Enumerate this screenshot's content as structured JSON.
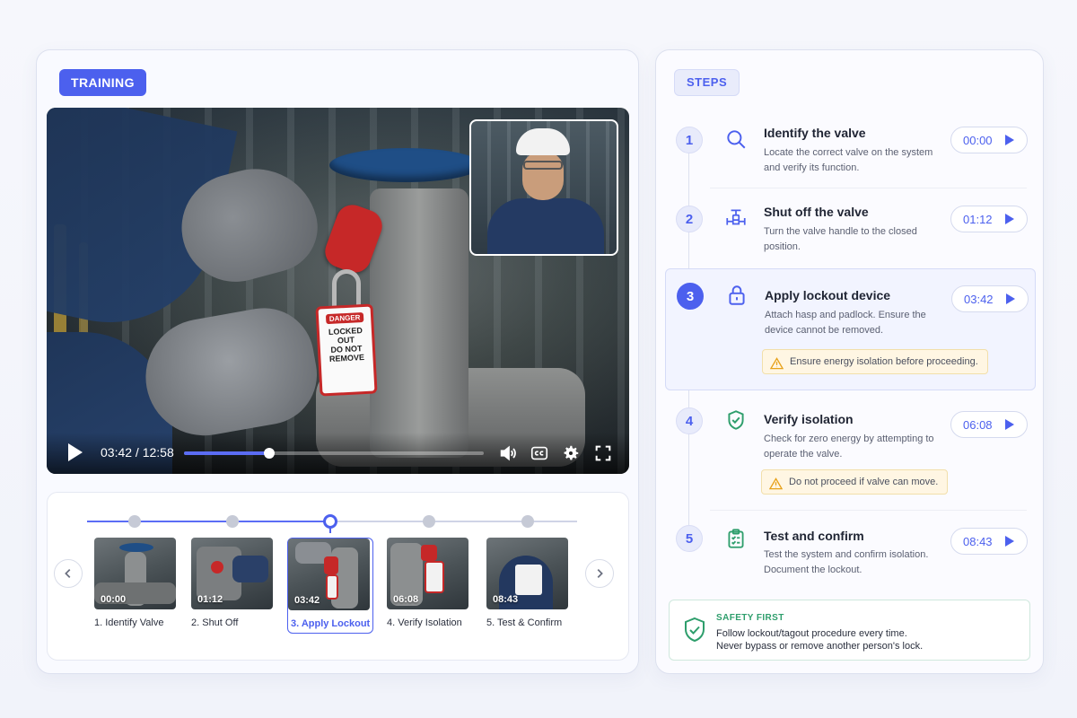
{
  "training_badge": "TRAINING",
  "steps_badge": "STEPS",
  "video": {
    "time_display": "03:42 / 12:58",
    "progress_fraction": 0.2856,
    "tag_danger": "DANGER",
    "tag_line1": "LOCKED",
    "tag_line2": "OUT",
    "tag_line3": "DO NOT",
    "tag_line4": "REMOVE"
  },
  "thumbnails": [
    {
      "time": "00:00",
      "label": "1. Identify Valve",
      "active": false
    },
    {
      "time": "01:12",
      "label": "2. Shut Off",
      "active": false
    },
    {
      "time": "03:42",
      "label": "3. Apply Lockout",
      "active": true
    },
    {
      "time": "06:08",
      "label": "4. Verify Isolation",
      "active": false
    },
    {
      "time": "08:43",
      "label": "5. Test & Confirm",
      "active": false
    }
  ],
  "steps": [
    {
      "num": "1",
      "title": "Identify the valve",
      "desc": "Locate the correct valve on the system and verify its function.",
      "time": "00:00",
      "icon": "search-icon"
    },
    {
      "num": "2",
      "title": "Shut off the valve",
      "desc": "Turn the valve handle to the closed position.",
      "time": "01:12",
      "icon": "valve-icon"
    },
    {
      "num": "3",
      "title": "Apply lockout device",
      "desc": "Attach hasp and padlock. Ensure the device cannot be removed.",
      "time": "03:42",
      "icon": "lock-icon",
      "warning": "Ensure energy isolation before proceeding."
    },
    {
      "num": "4",
      "title": "Verify isolation",
      "desc": "Check for zero energy by attempting to operate the valve.",
      "time": "06:08",
      "icon": "shield-check-icon",
      "warning": "Do not proceed if valve can move."
    },
    {
      "num": "5",
      "title": "Test and confirm",
      "desc": "Test the system and confirm isolation. Document the lockout.",
      "time": "08:43",
      "icon": "clipboard-check-icon"
    }
  ],
  "safety": {
    "title": "SAFETY FIRST",
    "line1": "Follow lockout/tagout procedure every time.",
    "line2": "Never bypass or remove another person's lock."
  },
  "colors": {
    "accent": "#4c60ee",
    "success": "#2e9e6c",
    "warning": "#e7a11a",
    "danger": "#c62828"
  }
}
